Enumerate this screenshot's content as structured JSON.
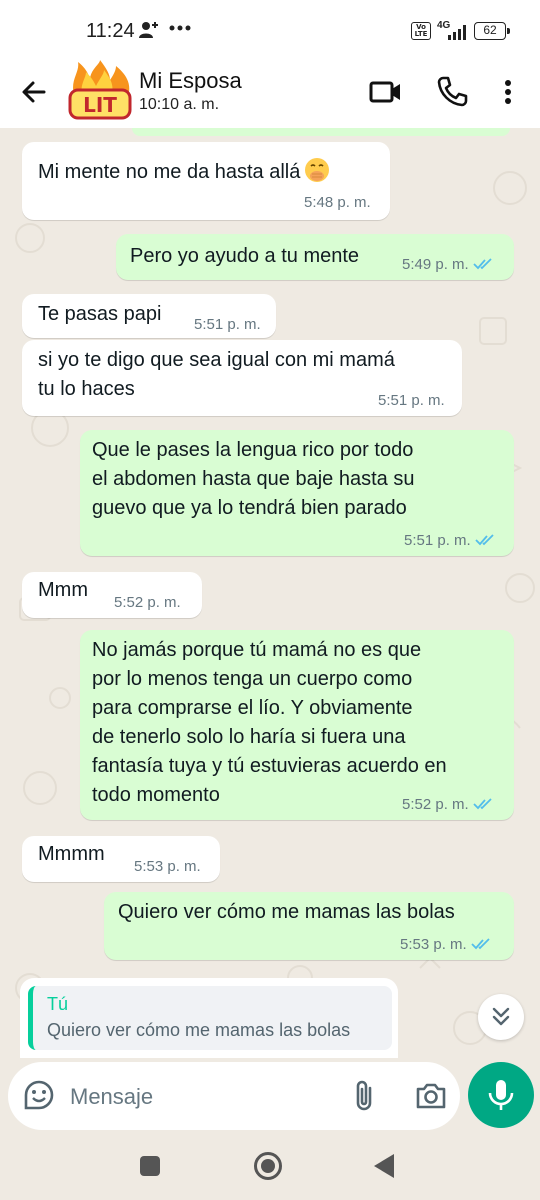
{
  "status_bar": {
    "time": "11:24",
    "network": "4G",
    "volte": "Vo LTE",
    "battery": "62"
  },
  "header": {
    "avatar_text": "LIT",
    "contact_name": "Mi Esposa",
    "contact_status": "10:10 a. m."
  },
  "messages": [
    {
      "direction": "in",
      "text": "Mi mente no me da hasta allá",
      "emoji": "face-with-hand-over-mouth",
      "time": "5:48 p. m."
    },
    {
      "direction": "out",
      "text": "Pero yo ayudo a tu mente",
      "time": "5:49 p. m.",
      "status": "read"
    },
    {
      "direction": "in",
      "text": "Te pasas papi",
      "time": "5:51 p. m."
    },
    {
      "direction": "in",
      "text": "si yo te digo que sea igual con mi mamá\ntu lo haces",
      "time": "5:51 p. m."
    },
    {
      "direction": "out",
      "text": "Que le pases la lengua rico por todo\nel abdomen hasta que baje hasta su\nguevo que ya lo tendrá bien parado",
      "time": "5:51 p. m.",
      "status": "read"
    },
    {
      "direction": "in",
      "text": "Mmm",
      "time": "5:52 p. m."
    },
    {
      "direction": "out",
      "text": "No jamás porque tú mamá no es que\npor lo menos tenga un cuerpo como\npara comprarse el lío. Y obviamente\nde tenerlo solo lo haría si fuera una\nfantasía tuya y tú estuvieras acuerdo en\ntodo momento",
      "time": "5:52 p. m.",
      "status": "read"
    },
    {
      "direction": "in",
      "text": "Mmmm",
      "time": "5:53 p. m."
    },
    {
      "direction": "out",
      "text": "Quiero ver cómo me mamas las bolas",
      "time": "5:53 p. m.",
      "status": "read"
    }
  ],
  "reply_preview": {
    "author": "Tú",
    "text": "Quiero ver cómo me mamas las bolas"
  },
  "composer": {
    "placeholder": "Mensaje"
  },
  "colors": {
    "outgoing_bubble": "#d9fdd3",
    "incoming_bubble": "#ffffff",
    "chat_bg": "#efeae2",
    "accent": "#00a884",
    "read_ticks": "#53bdeb"
  }
}
